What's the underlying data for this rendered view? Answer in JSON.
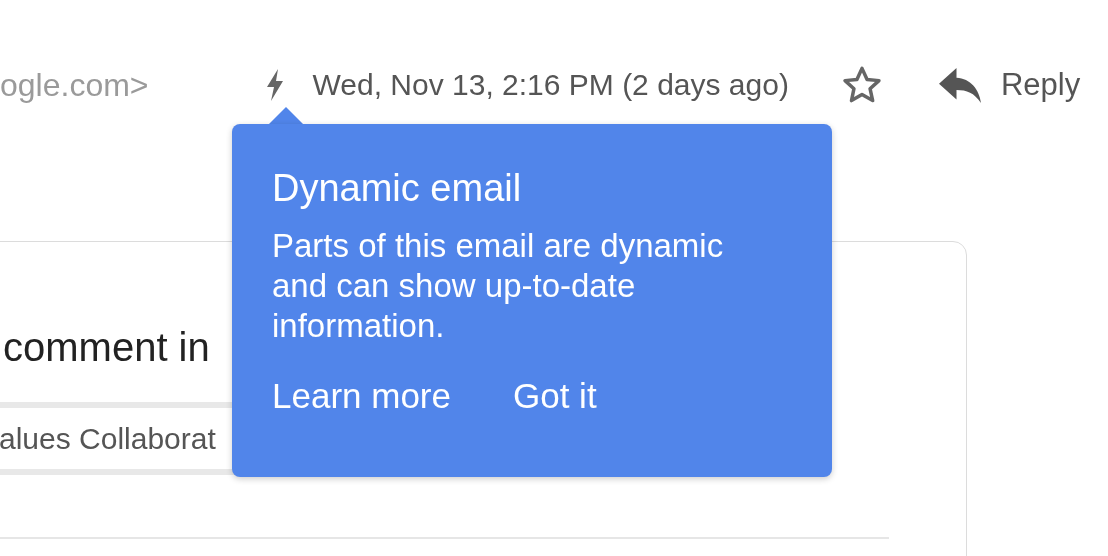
{
  "header": {
    "sender": "ogle.com>",
    "date": "Wed, Nov 13, 2:16 PM (2 days ago)",
    "starred": false,
    "reply_label": "Reply"
  },
  "message": {
    "heading": "comment in",
    "chip": "alues Collaborat"
  },
  "tooltip": {
    "title": "Dynamic email",
    "body": "Parts of this email are dynamic and can show up-to-date information.",
    "actions": [
      "Learn more",
      "Got it"
    ]
  }
}
